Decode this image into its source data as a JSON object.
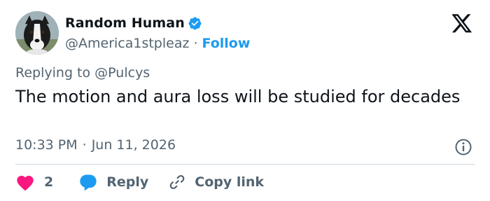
{
  "author": {
    "display_name": "Random Human",
    "handle": "@America1stpleaz",
    "separator": "·",
    "follow_label": "Follow",
    "verified": true,
    "avatar_icon": "dog-avatar"
  },
  "brand": {
    "logo_icon": "x-logo-icon"
  },
  "tweet": {
    "replying_prefix": "Replying to",
    "replying_to": "@Pulcys",
    "text": "The motion and aura loss will be studied for decades",
    "time": "10:33 PM",
    "meta_separator": "·",
    "date": "Jun 11, 2026"
  },
  "actions": {
    "like_count": "2",
    "reply_label": "Reply",
    "copy_link_label": "Copy link"
  },
  "colors": {
    "accent": "#1d9bf0",
    "like": "#f91880",
    "muted": "#536471",
    "text": "#0f1419"
  }
}
